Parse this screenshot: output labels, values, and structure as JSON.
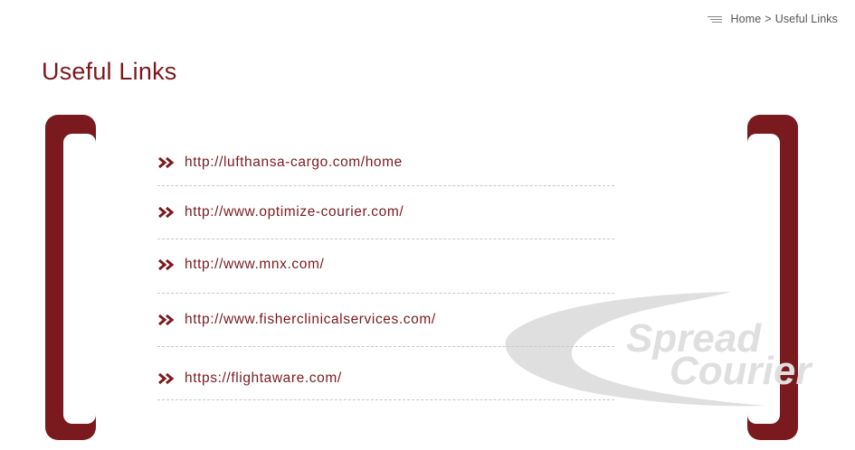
{
  "breadcrumb": {
    "home": "Home",
    "separator": ">",
    "current": "Useful Links"
  },
  "page": {
    "title": "Useful Links"
  },
  "links": [
    {
      "label": "http://lufthansa-cargo.com/home"
    },
    {
      "label": "http://www.optimize-courier.com/"
    },
    {
      "label": "http://www.mnx.com/"
    },
    {
      "label": "http://www.fisherclinicalservices.com/"
    },
    {
      "label": "https://flightaware.com/"
    }
  ],
  "watermark": {
    "line1": "Spread",
    "line2": "Courier"
  },
  "icons": {
    "menu": "menu-icon",
    "link_bullet": "double-chevron-right-icon"
  },
  "colors": {
    "brand": "#7a1a1e",
    "text_muted": "#555555",
    "divider": "#c8c8c8",
    "watermark": "#e0dfdf"
  }
}
